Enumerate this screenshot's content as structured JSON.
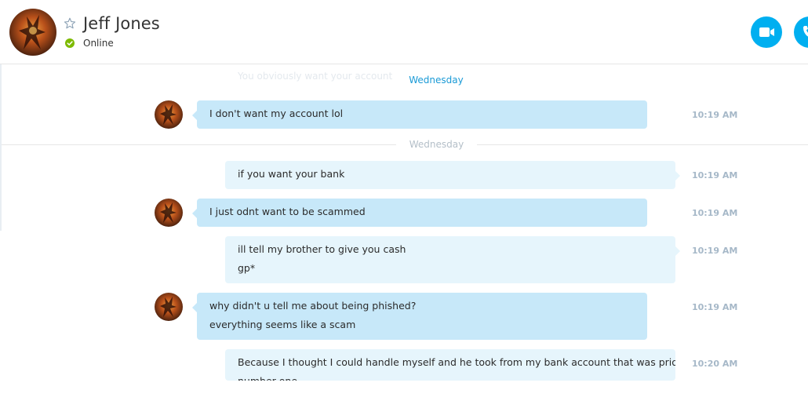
{
  "header": {
    "contact_name": "Jeff Jones",
    "status": "Online",
    "favorite_icon": "star-outline-icon",
    "status_icon": "online-check-icon",
    "video_call_icon": "video-camera-icon",
    "audio_call_icon": "phone-icon",
    "accent_color": "#00aff0",
    "online_color": "#7dba00"
  },
  "conversation": {
    "faded_preview": "You obviously want your account",
    "top_day_label": "Wednesday",
    "day_separator": "Wednesday",
    "messages": [
      {
        "direction": "in",
        "lines": [
          "I don't want my account lol"
        ],
        "time": "10:19 AM"
      },
      {
        "direction": "out",
        "lines": [
          "if you want your bank"
        ],
        "time": "10:19 AM"
      },
      {
        "direction": "in",
        "lines": [
          "I just odnt want to be scammed"
        ],
        "time": "10:19 AM"
      },
      {
        "direction": "out",
        "lines": [
          "ill tell my brother to give you cash",
          "gp*"
        ],
        "time": "10:19 AM"
      },
      {
        "direction": "in",
        "lines": [
          "why didn't u tell me about being phished?",
          "everything seems like a scam"
        ],
        "time": "10:19 AM"
      },
      {
        "direction": "out",
        "lines": [
          "Because I thought I could handle myself and he took from my bank account that was priortiy",
          "number one"
        ],
        "time": "10:20 AM"
      }
    ]
  }
}
